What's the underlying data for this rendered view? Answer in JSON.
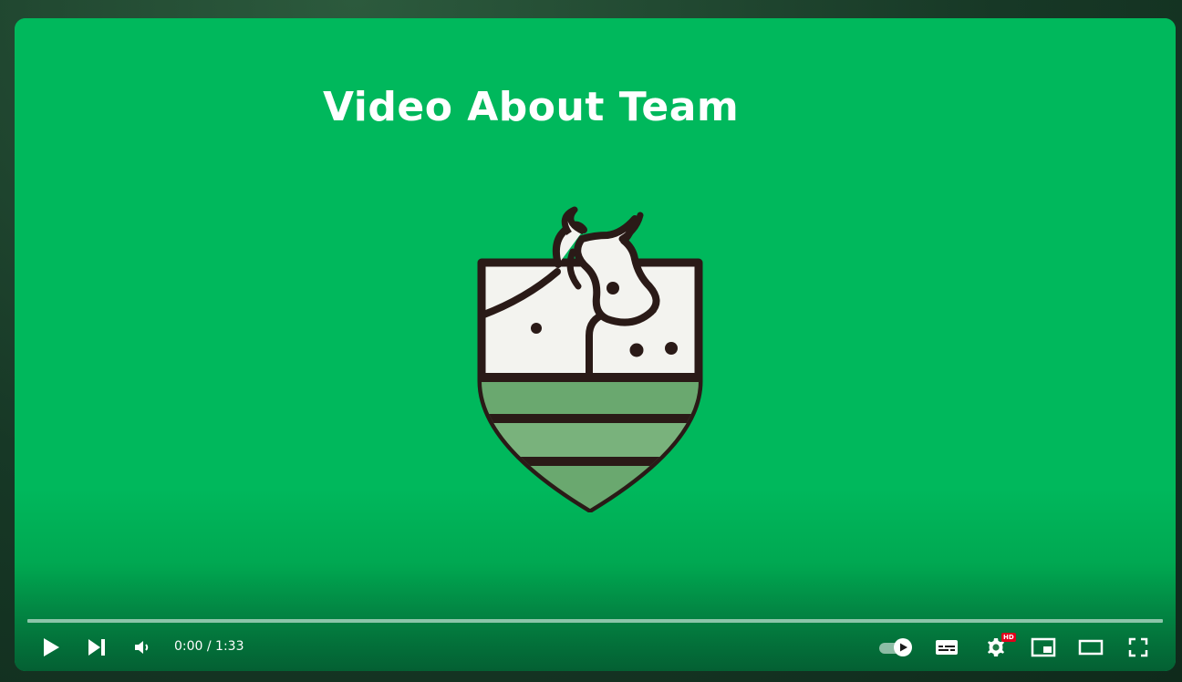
{
  "video": {
    "title_text": "Video About Team"
  },
  "player": {
    "time_display": "0:00 / 1:33",
    "progress_fraction": 0.0,
    "autoplay_on": true,
    "quality_badge": "HD"
  },
  "icons": {
    "play": "play-icon",
    "next": "next-icon",
    "volume": "volume-icon",
    "autoplay": "autoplay-toggle-icon",
    "subtitles": "subtitles-icon",
    "settings": "gear-icon",
    "miniplayer": "miniplayer-icon",
    "theater": "theater-mode-icon",
    "fullscreen": "fullscreen-icon"
  },
  "colors": {
    "screen_green": "#00b85c",
    "crest_outline": "#2a1a17",
    "crest_stripes": "#6aa86f",
    "crest_field": "#f3f3ef",
    "progress_played": "#ff0000",
    "hd_badge": "#e0001b"
  }
}
